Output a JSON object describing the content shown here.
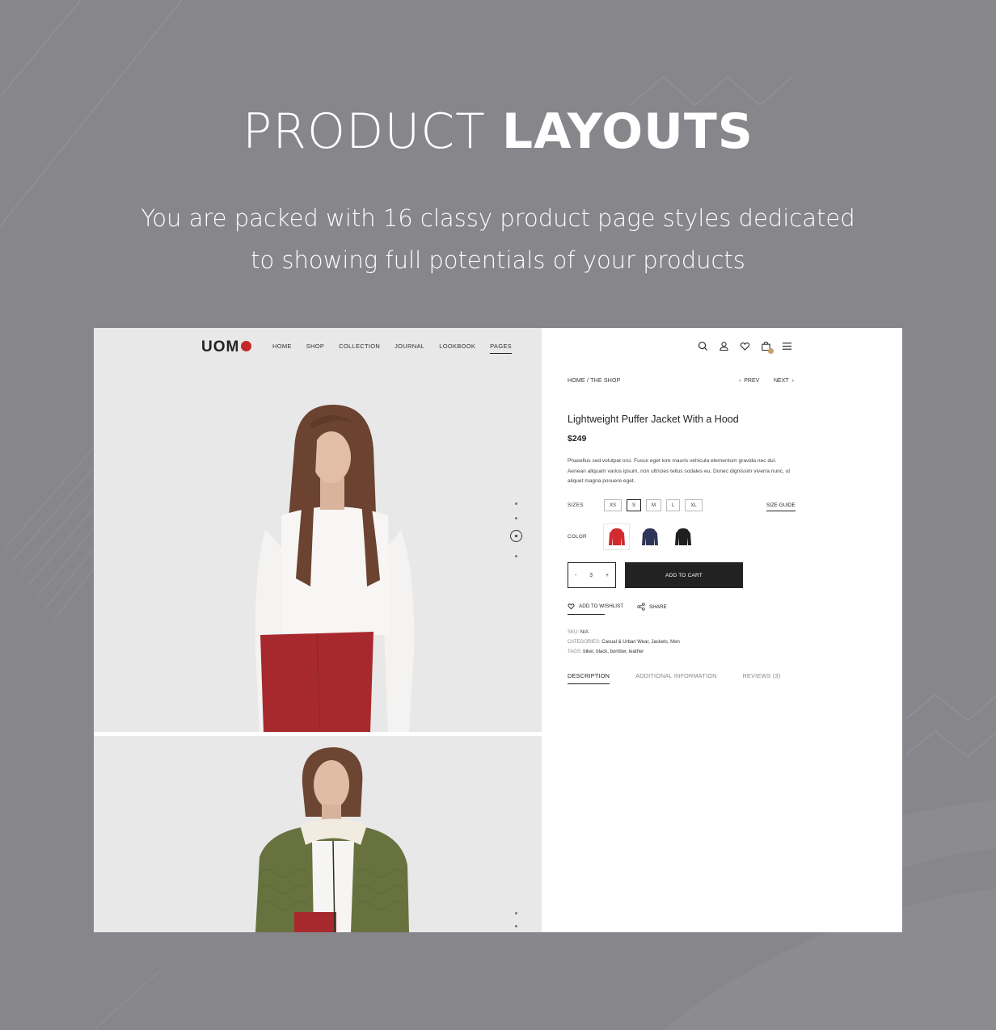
{
  "hero": {
    "title_light": "PRODUCT",
    "title_bold": "LAYOUTS",
    "subtitle_line1": "You are packed with 16 classy product page styles dedicated",
    "subtitle_line2": "to showing full potentials of your products"
  },
  "store": {
    "logo": "UOM",
    "brand_color": "#c32929",
    "nav": [
      {
        "label": "HOME"
      },
      {
        "label": "SHOP"
      },
      {
        "label": "COLLECTION"
      },
      {
        "label": "JOURNAL"
      },
      {
        "label": "LOOKBOOK"
      },
      {
        "label": "PAGES",
        "active": true
      }
    ],
    "header_icons": [
      "search-icon",
      "user-icon",
      "heart-icon",
      "cart-icon",
      "menu-icon"
    ],
    "gallery": {
      "slides": 4,
      "active_slide": 3
    }
  },
  "product": {
    "breadcrumb": "HOME / THE SHOP",
    "prev_label": "PREV",
    "next_label": "NEXT",
    "title": "Lightweight Puffer Jacket With a Hood",
    "price": "$249",
    "description": "Phasellus sed volutpat orci. Fusce eget lore mauris vehicula elementum gravida nec dui. Aenean aliquam varius ipsum, non ultricies tellus sodales eu. Donec dignissim viverra nunc, ut aliquet magna posuere eget.",
    "sizes_label": "SIZES",
    "sizes": [
      "XS",
      "S",
      "M",
      "L",
      "XL"
    ],
    "selected_size": "S",
    "size_guide_label": "SIZE GUIDE",
    "color_label": "COLOR",
    "colors": [
      {
        "name": "red",
        "hex": "#d22a2f",
        "selected": true
      },
      {
        "name": "navy",
        "hex": "#2e3558",
        "selected": false
      },
      {
        "name": "black",
        "hex": "#1f1f1f",
        "selected": false
      }
    ],
    "quantity": "3",
    "qty_minus": "-",
    "qty_plus": "+",
    "add_to_cart_label": "ADD TO CART",
    "wishlist_label": "ADD TO WISHLIST",
    "share_label": "SHARE",
    "sku_label": "SKU:",
    "sku_value": "N/A",
    "categories_label": "CATEGORIES:",
    "categories_value": "Casual & Urban Wear, Jackets, Men",
    "tags_label": "TAGS:",
    "tags_value": "biker, black, bomber, leather",
    "tabs": [
      {
        "label": "DESCRIPTION",
        "active": true
      },
      {
        "label": "ADDITIONAL INFORMATION"
      },
      {
        "label": "REVIEWS (3)"
      }
    ]
  }
}
